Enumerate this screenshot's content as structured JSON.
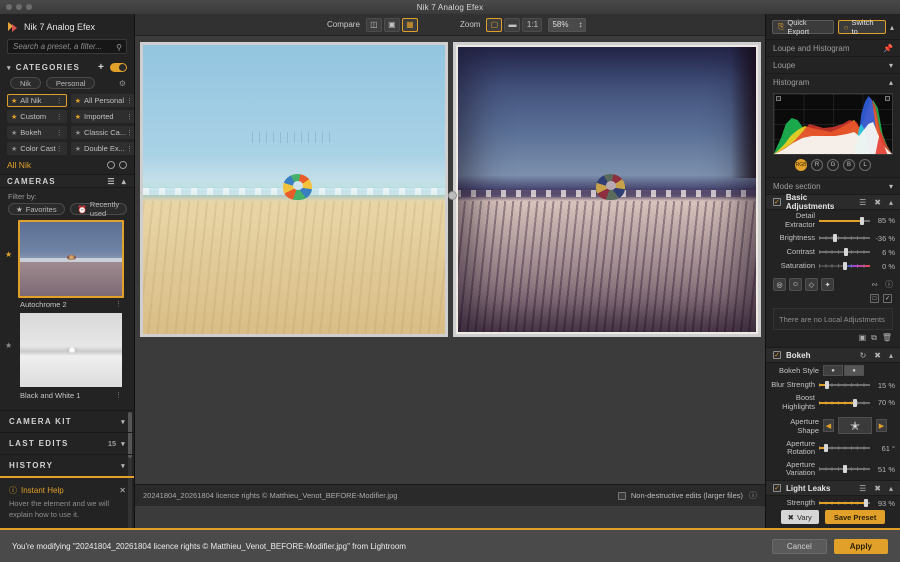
{
  "window": {
    "title": "Nik 7 Analog Efex"
  },
  "sidebar": {
    "brand": "Nik 7 Analog Efex",
    "search_placeholder": "Search a preset, a filter...",
    "categories": {
      "title": "CATEGORIES",
      "add_label": "+",
      "pills": [
        "Nik",
        "Personal"
      ],
      "items": [
        {
          "label": "All Nik",
          "selected": true,
          "starred": true
        },
        {
          "label": "All Personal",
          "selected": false,
          "starred": true
        },
        {
          "label": "Custom",
          "selected": false,
          "starred": true
        },
        {
          "label": "Imported",
          "selected": false,
          "starred": true
        },
        {
          "label": "Bokeh",
          "selected": false,
          "starred": false
        },
        {
          "label": "Classic Ca...",
          "selected": false,
          "starred": false
        },
        {
          "label": "Color Cast",
          "selected": false,
          "starred": false
        },
        {
          "label": "Double Ex...",
          "selected": false,
          "starred": false
        }
      ],
      "active_label": "All Nik"
    },
    "cameras": {
      "title": "CAMERAS",
      "filter_label": "Filter by:",
      "filter_pills": [
        "Favorites",
        "Recently used"
      ],
      "presets": [
        {
          "name": "Autochrome 2",
          "selected": true,
          "favorite": true
        },
        {
          "name": "Black and White 1",
          "selected": false,
          "favorite": true
        }
      ]
    },
    "sections": [
      {
        "label": "CAMERA KIT",
        "count": ""
      },
      {
        "label": "LAST EDITS",
        "count": "15"
      },
      {
        "label": "HISTORY",
        "count": ""
      }
    ],
    "instant_help": {
      "title": "Instant Help",
      "body": "Hover the element and we will explain how to use it.",
      "close": "✕"
    }
  },
  "toolbar": {
    "compare_label": "Compare",
    "compare_modes": [
      {
        "name": "split-view",
        "active": false
      },
      {
        "name": "side-by-side",
        "active": false
      },
      {
        "name": "before-after",
        "active": true
      }
    ],
    "zoom_label": "Zoom",
    "zoom_modes": [
      {
        "name": "fit-to-screen",
        "active": true
      },
      {
        "name": "fill-screen",
        "active": false
      },
      {
        "name": "one-to-one",
        "label": "1:1",
        "active": false
      }
    ],
    "zoom_value": "58%"
  },
  "canvas": {
    "filename": "20241804_20261804 licence rights © Matthieu_Venot_BEFORE-Modifier.jpg",
    "nondestructive_label": "Non-destructive edits (larger files)",
    "nondestructive_checked": false
  },
  "right": {
    "quick_export": "Quick Export",
    "switch_to": "Switch to",
    "loupe_histogram": "Loupe and Histogram",
    "loupe": "Loupe",
    "histogram": "Histogram",
    "channels": [
      {
        "label": "RGB",
        "active": true
      },
      {
        "label": "R",
        "active": false
      },
      {
        "label": "G",
        "active": false
      },
      {
        "label": "B",
        "active": false
      },
      {
        "label": "L",
        "active": false
      }
    ],
    "mode_section": "Mode section",
    "basic_adjustments": {
      "title": "Basic Adjustments",
      "enabled": true,
      "sliders": [
        {
          "label": "Detail Extractor",
          "value": "85 %",
          "pct": 85,
          "fill": true
        },
        {
          "label": "Brightness",
          "value": "-36 %",
          "pct": 32,
          "fill": false
        },
        {
          "label": "Contrast",
          "value": "6 %",
          "pct": 53,
          "fill": false
        },
        {
          "label": "Saturation",
          "value": "0 %",
          "pct": 50,
          "fill": false
        }
      ]
    },
    "local_adjustments": {
      "empty_text": "There are no Local Adjustments",
      "tools": [
        "control-point",
        "face-select",
        "shape-select",
        "brush"
      ]
    },
    "bokeh": {
      "title": "Bokeh",
      "enabled": true,
      "style_label": "Bokeh Style",
      "sliders": [
        {
          "label": "Blur Strength",
          "value": "15 %",
          "pct": 15,
          "fill": true
        },
        {
          "label": "Boost Highlights",
          "value": "70 %",
          "pct": 70,
          "fill": true
        }
      ],
      "aperture_shape_label": "Aperture Shape",
      "aperture_sliders": [
        {
          "label": "Aperture Rotation",
          "value": "61 °",
          "pct": 13,
          "fill": true
        },
        {
          "label": "Aperture Variation",
          "value": "51 %",
          "pct": 51,
          "fill": false
        }
      ]
    },
    "light_leaks": {
      "title": "Light Leaks",
      "enabled": true,
      "sliders": [
        {
          "label": "Strength",
          "value": "93 %",
          "pct": 93,
          "fill": true
        }
      ]
    },
    "vary_label": "Vary",
    "save_preset_label": "Save Preset"
  },
  "bottom": {
    "message": "You're modifying \"20241804_20261804 licence rights © Matthieu_Venot_BEFORE-Modifier.jpg\" from Lightroom",
    "cancel": "Cancel",
    "apply": "Apply"
  },
  "colors": {
    "accent": "#e0a02a",
    "panel": "#232323",
    "canvas": "#3b3b3b"
  }
}
